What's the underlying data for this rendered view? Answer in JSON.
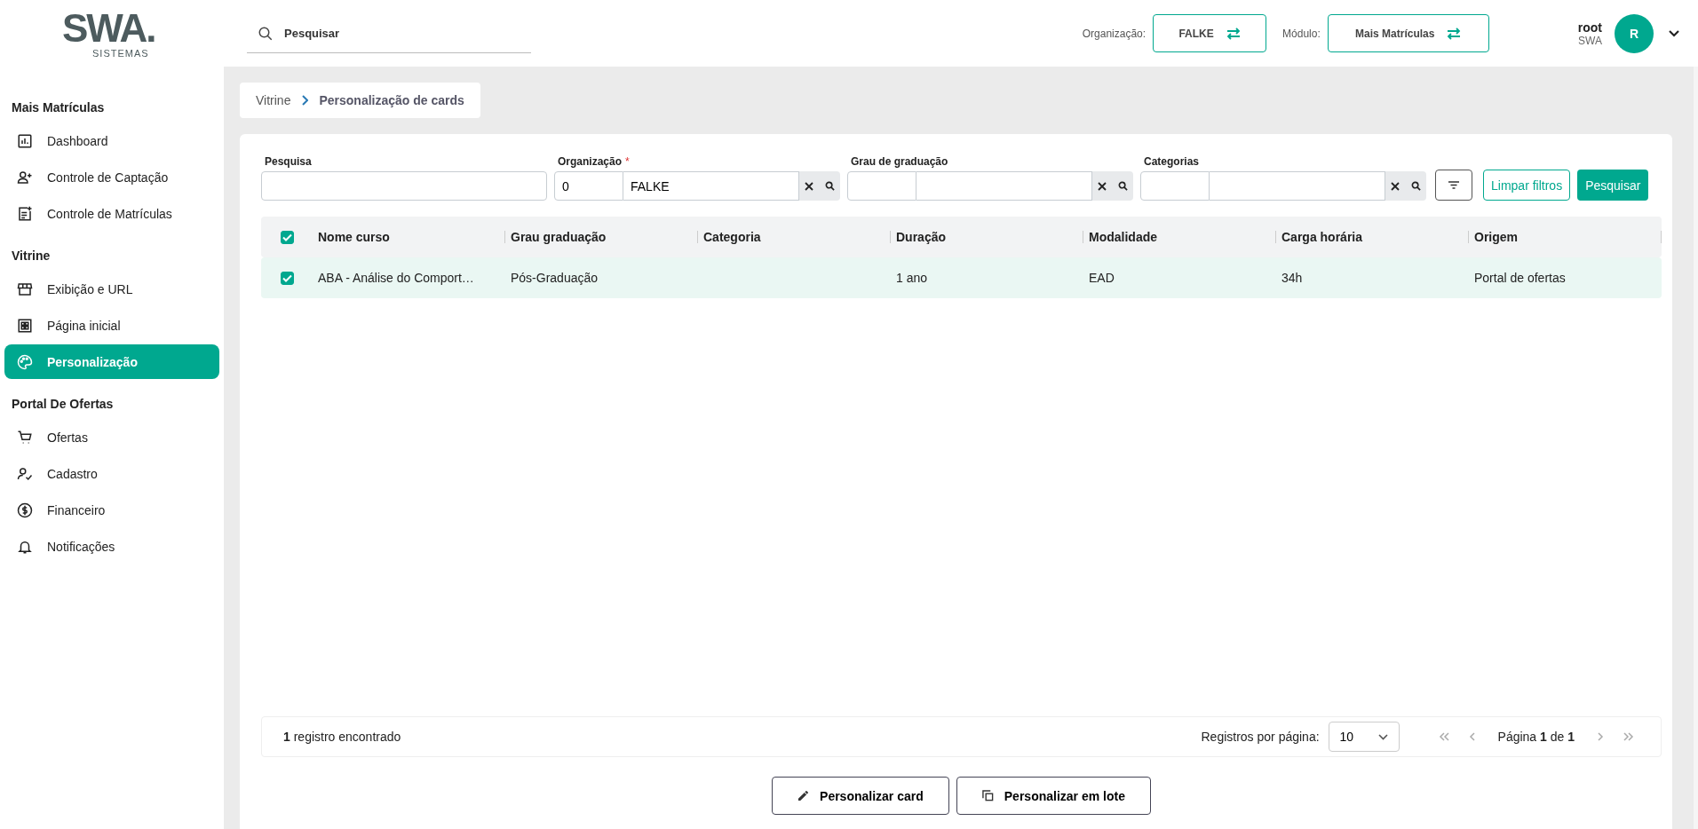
{
  "logo": {
    "mark": "SWA.",
    "sub": "SISTEMAS"
  },
  "search": {
    "placeholder": "Pesquisar"
  },
  "header": {
    "org_label": "Organização:",
    "org_value": "FALKE",
    "module_label": "Módulo:",
    "module_value": "Mais Matrículas",
    "user": "root",
    "company": "SWA",
    "avatar": "R"
  },
  "sidebar": [
    {
      "title": "Mais Matrículas",
      "items": [
        {
          "label": "Dashboard",
          "selected": false
        },
        {
          "label": "Controle de Captação",
          "selected": false
        },
        {
          "label": "Controle de Matrículas",
          "selected": false
        }
      ]
    },
    {
      "title": "Vitrine",
      "items": [
        {
          "label": "Exibição e URL",
          "selected": false
        },
        {
          "label": "Página inicial",
          "selected": false
        },
        {
          "label": "Personalização",
          "selected": true
        }
      ]
    },
    {
      "title": "Portal De Ofertas",
      "items": [
        {
          "label": "Ofertas",
          "selected": false
        },
        {
          "label": "Cadastro",
          "selected": false
        },
        {
          "label": "Financeiro",
          "selected": false
        },
        {
          "label": "Notificações",
          "selected": false
        }
      ]
    }
  ],
  "breadcrumb": [
    "Vitrine",
    "Personalização de cards"
  ],
  "filters": [
    {
      "label": "Pesquisa",
      "kind": "text"
    },
    {
      "label": "Organização",
      "kind": "lookup",
      "required_mark": "*",
      "code": "0",
      "value": "FALKE"
    },
    {
      "label": "Grau de graduação",
      "kind": "lookup"
    },
    {
      "label": "Categorias",
      "kind": "lookup"
    }
  ],
  "filter_buttons": {
    "clear": "Limpar filtros",
    "search": "Pesquisar"
  },
  "table": {
    "all_checked": true,
    "columns": [
      "Nome curso",
      "Grau graduação",
      "Categoria",
      "Duração",
      "Modalidade",
      "Carga horária",
      "Origem"
    ],
    "rows": [
      {
        "checked": true,
        "cells": [
          "ABA - Análise do Comport…",
          "Pós-Graduação",
          "",
          "1 ano",
          "EAD",
          "34h",
          "Portal de ofertas"
        ]
      }
    ]
  },
  "footer": {
    "count": "**1** registro encontrado",
    "per_page_label": "Registros por página:",
    "per_page": "10",
    "page": "Página **1** de **1**"
  },
  "actions": [
    "Personalizar card",
    "Personalizar em lote"
  ]
}
